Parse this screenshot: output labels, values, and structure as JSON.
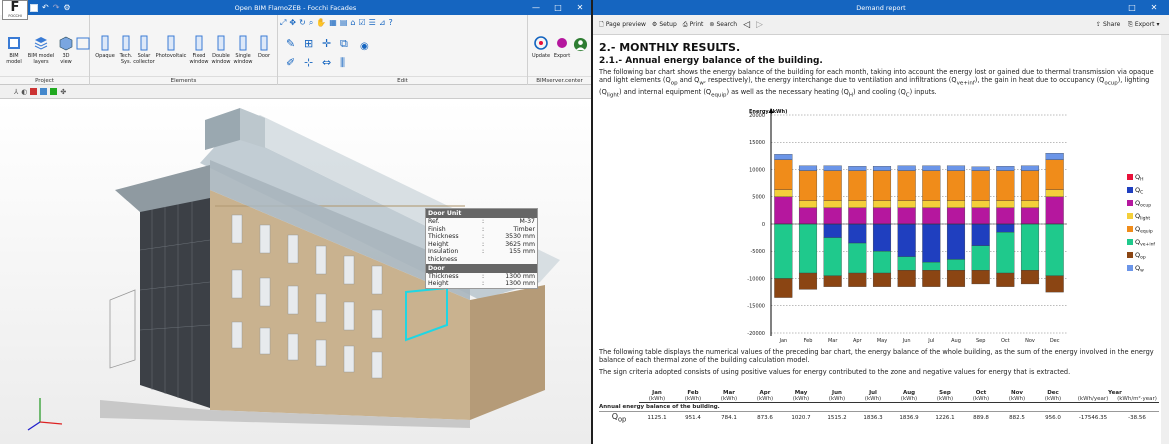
{
  "left_window": {
    "title": "Open BIM FlamoZEB - Focchi Facades",
    "logo_text": "F",
    "logo_sub": "FOCCHI",
    "ribbon": {
      "project": {
        "label": "Project",
        "buttons": [
          "BIM model",
          "BIM model layers",
          "3D view"
        ]
      },
      "elements": {
        "label": "Elements",
        "buttons": [
          "Opaque",
          "Tech. Sys.",
          "Solar collector",
          "Photovoltaic",
          "Fixed window",
          "Double window",
          "Single window",
          "Door"
        ]
      },
      "edit": {
        "label": "Edit"
      },
      "bimserver": {
        "label": "BIMserver.center",
        "buttons": [
          "Update",
          "Export"
        ]
      }
    },
    "popup": {
      "title": "Door Unit",
      "rows": [
        {
          "k": "Ref.",
          "v": "M-37"
        },
        {
          "k": "Finish",
          "v": "Timber"
        },
        {
          "k": "Thickness",
          "v": "3530 mm"
        },
        {
          "k": "Height",
          "v": "3625 mm"
        },
        {
          "k": "Insulation thickness",
          "v": "155 mm"
        }
      ],
      "section2": "Door",
      "rows2": [
        {
          "k": "Thickness",
          "v": "1300 mm"
        },
        {
          "k": "Height",
          "v": "1300 mm"
        }
      ]
    }
  },
  "right_window": {
    "title": "Demand report",
    "toolbar": {
      "page_preview": "Page preview",
      "setup": "Setup",
      "print": "Print",
      "search": "Search",
      "share": "Share",
      "export": "Export"
    },
    "doc": {
      "h1": "2.- MONTHLY RESULTS.",
      "h2": "2.1.- Annual energy balance of the building.",
      "p1a": "The following bar chart shows the energy balance of the building for each month, taking into account the energy lost or gained due to thermal transmission via opaque and light elements (Q",
      "p1_op": "op",
      "p1b": " and Q",
      "p1_w": "w",
      "p1c": ", respectively), the energy interchange due to ventilation and infiltrations (Q",
      "p1_ve": "ve+inf",
      "p1d": "), the gain in heat due to occupancy (Q",
      "p1_ocup": "ocup",
      "p1e": "), lighting (Q",
      "p1_light": "light",
      "p1f": ") and internal equipment (Q",
      "p1_equip": "equip",
      "p1g": ") as well as the necessary heating (Q",
      "p1_H": "H",
      "p1h": ") and cooling (Q",
      "p1_C": "C",
      "p1i": ") inputs.",
      "p2": "The following table displays the numerical values of the preceding bar chart, the energy balance of the whole building, as the sum of the energy involved in the energy balance of each thermal zone of the building calculation model.",
      "p3": "The sign criteria adopted consists of using positive values for energy contributed to the zone and negative values for energy that is extracted."
    },
    "table": {
      "months": [
        "Jan",
        "Feb",
        "Mar",
        "Apr",
        "May",
        "Jun",
        "Jul",
        "Aug",
        "Sep",
        "Oct",
        "Nov",
        "Dec"
      ],
      "unit": "(kWh)",
      "year_label": "Year",
      "year_units": [
        "(kWh/year)",
        "(kWh/m²·year)"
      ],
      "section": "Annual energy balance of the building.",
      "row_label": "Q",
      "row_sub": "op",
      "row_values": [
        "1125.1",
        "951.4",
        "784.1",
        "873.6",
        "1020.7",
        "1515.2",
        "1836.3",
        "1836.9",
        "1226.1",
        "889.8",
        "882.5",
        "956.0"
      ],
      "row_year": [
        "-17546.35",
        "-38.56"
      ]
    }
  },
  "chart_data": {
    "type": "bar",
    "title": "",
    "ylabel": "Energy (kWh)",
    "xlabel": "",
    "ylim": [
      -20000,
      20000
    ],
    "yticks": [
      -20000,
      -15000,
      -10000,
      -5000,
      0,
      5000,
      10000,
      15000,
      20000
    ],
    "grid": true,
    "legend_position": "right",
    "categories": [
      "Jan",
      "Feb",
      "Mar",
      "Apr",
      "May",
      "Jun",
      "Jul",
      "Aug",
      "Sep",
      "Oct",
      "Nov",
      "Dec"
    ],
    "series": [
      {
        "name": "QH",
        "label": "Q",
        "sub": "H",
        "color": "#e8113a",
        "values": [
          0,
          0,
          0,
          0,
          0,
          0,
          0,
          0,
          0,
          0,
          0,
          0
        ]
      },
      {
        "name": "QC",
        "label": "Q",
        "sub": "C",
        "color": "#1f3fbf",
        "values": [
          0,
          0,
          -2500,
          -3500,
          -5000,
          -6000,
          -7000,
          -6500,
          -4000,
          -1500,
          0,
          0
        ]
      },
      {
        "name": "Qocup",
        "label": "Q",
        "sub": "ocup",
        "color": "#b5179e",
        "values": [
          5000,
          3000,
          3000,
          3000,
          3000,
          3000,
          3000,
          3000,
          3000,
          3000,
          3000,
          5000
        ]
      },
      {
        "name": "Qlight",
        "label": "Q",
        "sub": "light",
        "color": "#f4cf3a",
        "values": [
          1300,
          1300,
          1300,
          1300,
          1300,
          1300,
          1300,
          1300,
          1300,
          1300,
          1300,
          1300
        ]
      },
      {
        "name": "Qequip",
        "label": "Q",
        "sub": "equip",
        "color": "#f08c1a",
        "values": [
          5500,
          5500,
          5500,
          5500,
          5500,
          5500,
          5500,
          5500,
          5500,
          5500,
          5500,
          5500
        ]
      },
      {
        "name": "Qve+inf",
        "label": "Q",
        "sub": "ve+inf",
        "color": "#1fc98c",
        "values": [
          -10000,
          -9000,
          -7000,
          -5500,
          -4000,
          -2500,
          -1500,
          -2000,
          -4500,
          -7500,
          -8500,
          -9500
        ]
      },
      {
        "name": "Qop",
        "label": "Q",
        "sub": "op",
        "color": "#8b4513",
        "values": [
          -3500,
          -3000,
          -2000,
          -2500,
          -2500,
          -3000,
          -3000,
          -3000,
          -2500,
          -2500,
          -2500,
          -3000
        ]
      },
      {
        "name": "Qw",
        "label": "Q",
        "sub": "w",
        "color": "#6b95e8",
        "values": [
          1000,
          900,
          900,
          800,
          800,
          900,
          900,
          900,
          700,
          800,
          900,
          1200
        ]
      }
    ]
  }
}
